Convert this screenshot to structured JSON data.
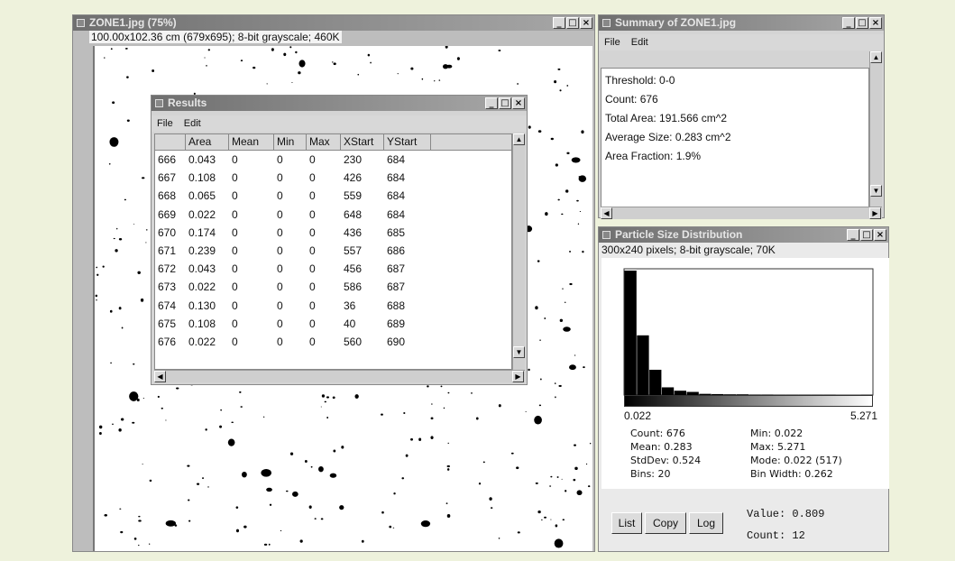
{
  "image_window": {
    "title": "ZONE1.jpg (75%)",
    "info": "100.00x102.36 cm (679x695); 8-bit grayscale; 460K"
  },
  "results_window": {
    "title": "Results",
    "menu": [
      "File",
      "Edit"
    ],
    "columns": [
      "",
      "Area",
      "Mean",
      "Min",
      "Max",
      "XStart",
      "YStart"
    ],
    "rows": [
      [
        "666",
        "0.043",
        "0",
        "0",
        "0",
        "230",
        "684"
      ],
      [
        "667",
        "0.108",
        "0",
        "0",
        "0",
        "426",
        "684"
      ],
      [
        "668",
        "0.065",
        "0",
        "0",
        "0",
        "559",
        "684"
      ],
      [
        "669",
        "0.022",
        "0",
        "0",
        "0",
        "648",
        "684"
      ],
      [
        "670",
        "0.174",
        "0",
        "0",
        "0",
        "436",
        "685"
      ],
      [
        "671",
        "0.239",
        "0",
        "0",
        "0",
        "557",
        "686"
      ],
      [
        "672",
        "0.043",
        "0",
        "0",
        "0",
        "456",
        "687"
      ],
      [
        "673",
        "0.022",
        "0",
        "0",
        "0",
        "586",
        "687"
      ],
      [
        "674",
        "0.130",
        "0",
        "0",
        "0",
        "36",
        "688"
      ],
      [
        "675",
        "0.108",
        "0",
        "0",
        "0",
        "40",
        "689"
      ],
      [
        "676",
        "0.022",
        "0",
        "0",
        "0",
        "560",
        "690"
      ]
    ]
  },
  "summary_window": {
    "title": "Summary of ZONE1.jpg",
    "menu": [
      "File",
      "Edit"
    ],
    "lines": [
      "Threshold: 0-0",
      "Count: 676",
      "Total Area: 191.566 cm^2",
      "Average Size: 0.283 cm^2",
      "Area Fraction: 1.9%"
    ]
  },
  "histogram_window": {
    "title": "Particle Size Distribution",
    "info": "300x240 pixels; 8-bit grayscale; 70K",
    "x_min_label": "0.022",
    "x_max_label": "5.271",
    "stats_left": [
      "Count: 676",
      "Mean: 0.283",
      "StdDev: 0.524",
      "Bins: 20"
    ],
    "stats_right": [
      "Min: 0.022",
      "Max: 5.271",
      "Mode: 0.022 (517)",
      "Bin Width: 0.262"
    ],
    "buttons": {
      "list": "List",
      "copy": "Copy",
      "log": "Log"
    },
    "value_readout": "Value: 0.809",
    "count_readout": "Count: 12"
  },
  "chart_data": {
    "type": "bar",
    "title": "",
    "xlabel": "",
    "ylabel": "",
    "x_range": [
      0.022,
      5.271
    ],
    "bins": 20,
    "values": [
      517,
      248,
      105,
      32,
      18,
      13,
      5,
      4,
      3,
      3,
      2,
      2,
      1,
      1,
      1,
      1,
      1,
      0,
      0,
      1
    ]
  }
}
